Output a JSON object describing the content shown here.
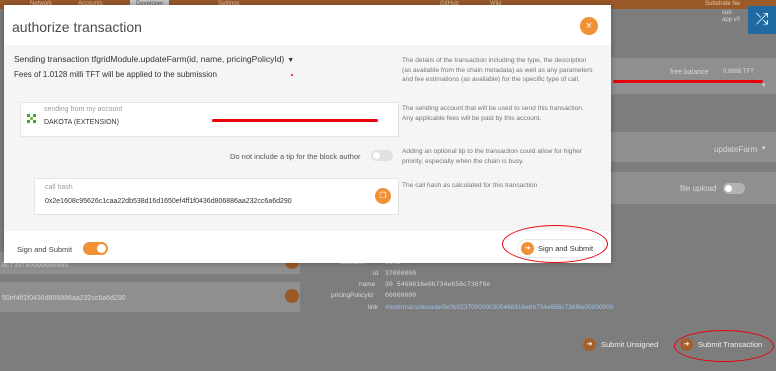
{
  "nav": {
    "tabs": [
      "Network",
      "Accounts",
      "Developer",
      "Settings",
      "GitHub",
      "Wiki"
    ],
    "active_tab": "Developer"
  },
  "header_right": {
    "line1": "Substrate Ne",
    "line2": "sub",
    "line3": "app v0"
  },
  "modal": {
    "title": "authorize transaction",
    "close_label": "×",
    "transaction_label": "Sending transaction tfgridModule.updateFarm(id, name, pricingPolicyId)",
    "fees_text": "Fees of 1.0128 milli TFT will be applied to the submission",
    "help_transaction": "The details of the transaction including the type, the description (as available from the chain metadata) as well as any parameters and fee estimations (as available) for the specific type of call.",
    "account_label": "sending from my account",
    "account_name": "DAKOTA (EXTENSION)",
    "help_account": "The sending account that will be used to send this transaction. Any applicable fees will be paid by this account.",
    "tip_label": "Do not include a tip for the block author",
    "help_tip": "Adding an optional tip to the transaction could allow for higher priority, especially when the chain is busy.",
    "call_hash_label": "call hash",
    "call_hash_value": "0x2e1608c95626c1caa22db538d16d1650ef4ff1f0436d806886aa232cc6a6d290",
    "help_call_hash": "The call hash as calculated for this transaction",
    "sign_submit_toggle_label": "Sign and Submit",
    "submit_button_label": "Sign and Submit"
  },
  "background": {
    "free_balance_label": "free balance",
    "free_balance_value": "0.9888 TFT",
    "method_value": "updateFarm",
    "file_upload_label": "file upload",
    "left_hash_1": "0cf30f80000000000",
    "left_hash_2": "50ef4ff1f0436d806886aa232cc6a6d290",
    "fields": [
      {
        "label": "callindex",
        "value": "0002"
      },
      {
        "label": "id",
        "value": "37000000"
      },
      {
        "label": "name",
        "value": "30 5468616e6b734e656c736f6e"
      },
      {
        "label": "pricingPolicyId",
        "value": "00000000"
      },
      {
        "label": "link",
        "value": "#/extrinsics/decode/0x0b0237000000305468616e6b734e656c736f6e00000000"
      }
    ],
    "submit_unsigned_label": "Submit Unsigned",
    "submit_transaction_label": "Submit Transaction"
  },
  "colors": {
    "accent": "#f19135",
    "annotation_red": "#e8000a",
    "shuffle_blue": "#1f6aa0"
  }
}
